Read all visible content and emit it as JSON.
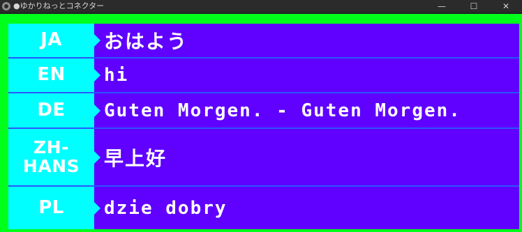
{
  "window": {
    "title": "●ゆかりねっとコネクター",
    "controls": {
      "minimize": "—",
      "maximize": "☐",
      "close": "✕"
    }
  },
  "rows": [
    {
      "lang": "JA",
      "text": "おはよう"
    },
    {
      "lang": "EN",
      "text": "hi"
    },
    {
      "lang": "DE",
      "text": "Guten Morgen. - Guten Morgen."
    },
    {
      "lang": "ZH-\nHANS",
      "text": "早上好"
    },
    {
      "lang": "PL",
      "text": "dzie  dobry"
    }
  ],
  "colors": {
    "border": "#00ff1b",
    "lang_bg": "#00ffff",
    "text_bg": "#6000ff",
    "divider": "#2b57ff"
  }
}
